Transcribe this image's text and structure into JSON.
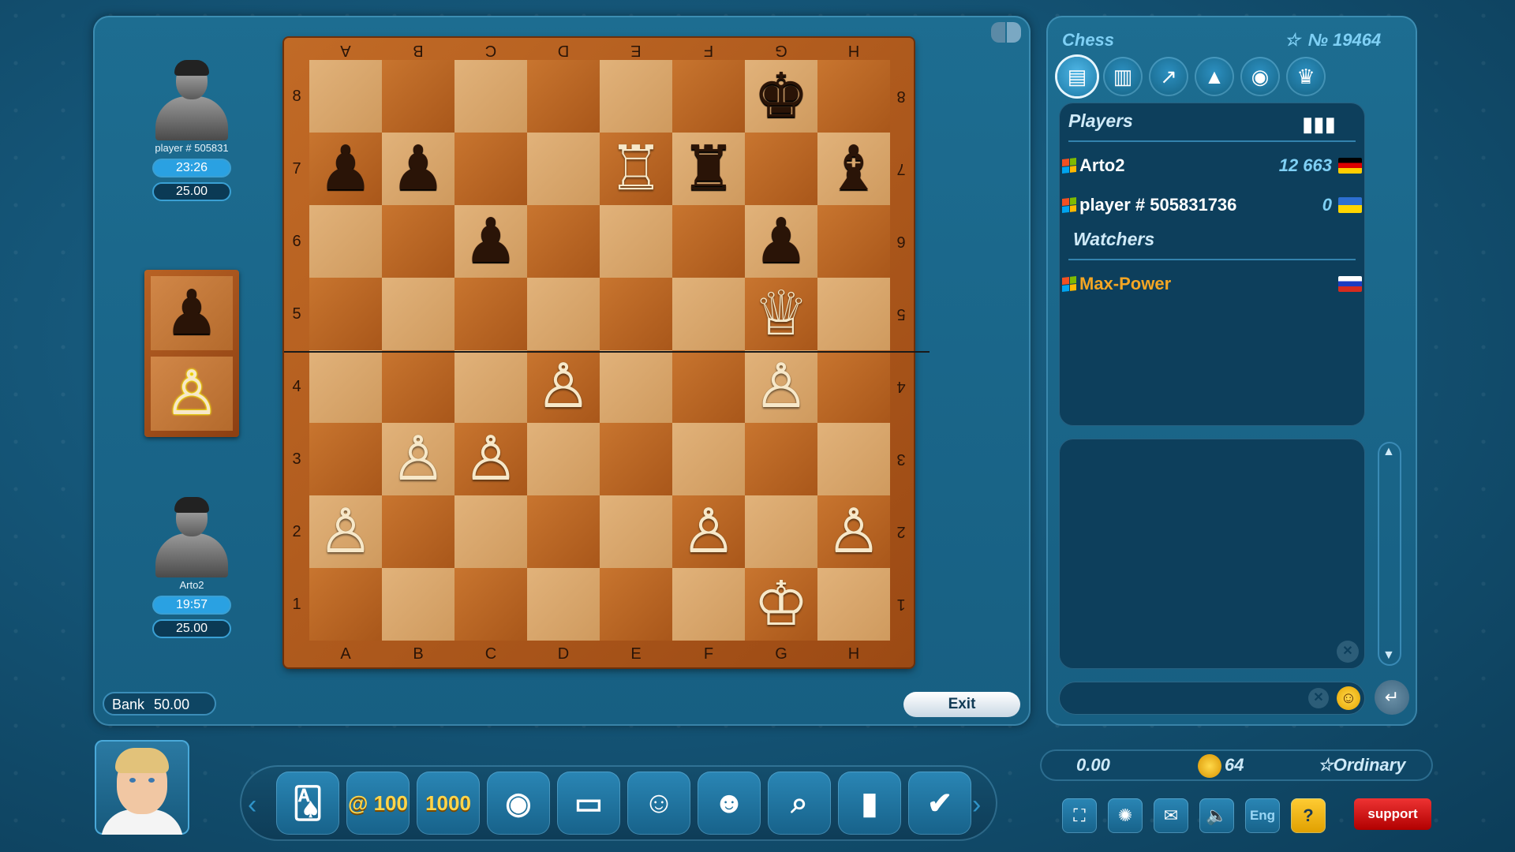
{
  "players": {
    "top": {
      "name": "player # 505831",
      "timer": "23:26",
      "stake": "25.00"
    },
    "bottom": {
      "name": "Arto2",
      "timer": "19:57",
      "stake": "25.00"
    }
  },
  "captured": [
    {
      "piece": "♟",
      "color": "b"
    },
    {
      "piece": "♙",
      "color": "w-hl"
    }
  ],
  "board": {
    "files_top": [
      "A",
      "B",
      "C",
      "D",
      "E",
      "F",
      "G",
      "H"
    ],
    "files_bottom": [
      "A",
      "B",
      "C",
      "D",
      "E",
      "F",
      "G",
      "H"
    ],
    "ranks": [
      "8",
      "7",
      "6",
      "5",
      "4",
      "3",
      "2",
      "1"
    ],
    "position": [
      [
        "",
        "",
        "",
        "",
        "",
        "",
        "bk",
        ""
      ],
      [
        "bp",
        "bp",
        "",
        "",
        "wr",
        "br",
        "",
        "bb"
      ],
      [
        "",
        "",
        "bp",
        "",
        "",
        "",
        "bp",
        ""
      ],
      [
        "",
        "",
        "",
        "",
        "",
        "",
        "wq",
        ""
      ],
      [
        "",
        "",
        "",
        "wp",
        "",
        "",
        "wp",
        ""
      ],
      [
        "",
        "wp",
        "wp",
        "",
        "",
        "",
        "",
        ""
      ],
      [
        "wp",
        "",
        "",
        "",
        "",
        "wp",
        "",
        "wp"
      ],
      [
        "",
        "",
        "",
        "",
        "",
        "",
        "wk",
        ""
      ]
    ]
  },
  "bank": {
    "label": "Bank",
    "value": "50.00"
  },
  "exit_label": "Exit",
  "side": {
    "title": "Chess",
    "number": "№ 19464",
    "tabs": [
      "chat-icon",
      "stats-icon",
      "growth-icon",
      "graduation-icon",
      "camera-icon",
      "trophy-icon"
    ],
    "players_heading": "Players",
    "player_list": [
      {
        "name": "Arto2",
        "score": "12 663",
        "flag": "de"
      },
      {
        "name": "player # 505831736",
        "score": "0",
        "flag": "ua"
      }
    ],
    "watchers_heading": "Watchers",
    "watchers": [
      {
        "name": "Max-Power",
        "flag": "ru",
        "color": "#f5a623"
      }
    ]
  },
  "dock": {
    "items": [
      "cards-icon",
      "@ 100",
      "1000",
      "coin-icon",
      "wallet-icon",
      "emoji-icon",
      "friends-icon",
      "search-icon",
      "chart-icon",
      "check-icon"
    ]
  },
  "balance": {
    "money": "0.00",
    "coins": "64",
    "rank": "Ordinary"
  },
  "utilities": {
    "lang": "Eng",
    "help": "?",
    "support": "support"
  }
}
